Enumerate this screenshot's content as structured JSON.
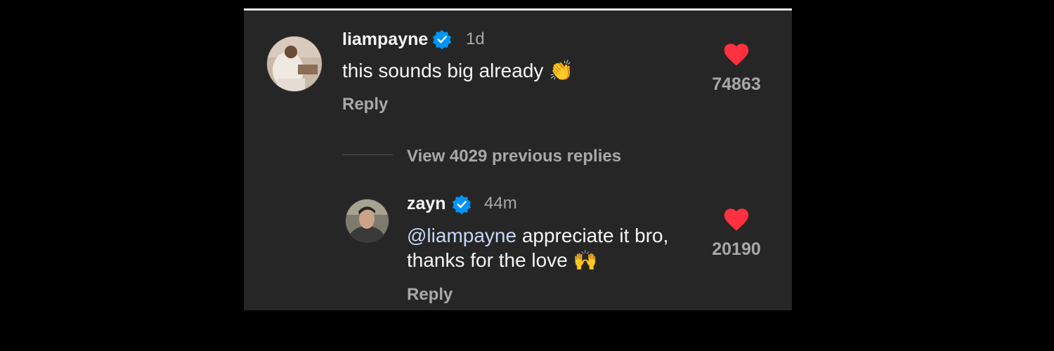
{
  "comments": [
    {
      "username": "liampayne",
      "time": "1d",
      "text": "this sounds big already",
      "emoji": "👏",
      "emoji_icon": "clapping-hands-icon",
      "reply_label": "Reply",
      "likes": "74863"
    }
  ],
  "view_replies_label": "View 4029 previous replies",
  "reply": {
    "username": "zayn",
    "time": "44m",
    "mention": "@liampayne",
    "text_line1": " appreciate it bro,",
    "text_line2": "thanks for the love",
    "emoji": "🙌",
    "emoji_icon": "raising-hands-icon",
    "reply_label": "Reply",
    "likes": "20190"
  },
  "colors": {
    "background": "#262626",
    "heart": "#ff3040",
    "verified": "#0095f6",
    "primary_text": "#f5f5f5",
    "secondary_text": "#a8a8a8",
    "mention": "#c7d7f5"
  }
}
